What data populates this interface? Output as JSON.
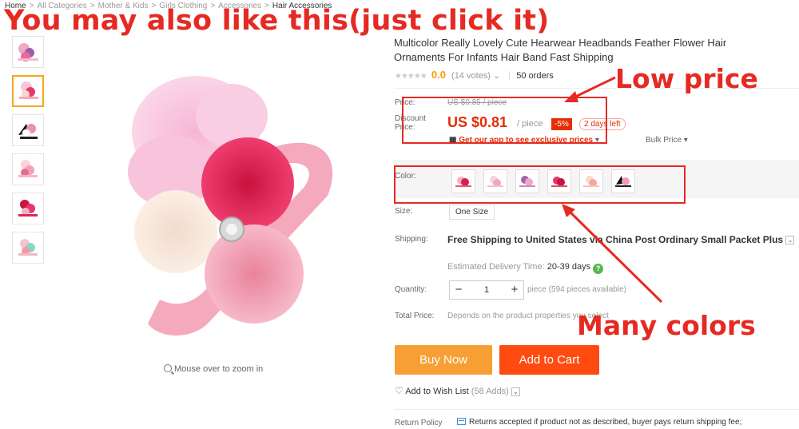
{
  "breadcrumb": [
    "Home",
    "All Categories",
    "Mother & Kids",
    "Girls Clothing",
    "Accessories",
    "Hair Accessories"
  ],
  "breadcrumb_sep": ">",
  "overlay_banner": "You may also like this(just click it)",
  "product": {
    "title": "Multicolor Really Lovely Cute Hearwear Headbands Feather Flower Hair Ornaments For Infants Hair Band Fast Shipping",
    "rating_value": "0.0",
    "votes": "(14 votes)",
    "orders": "50 orders"
  },
  "price": {
    "label": "Price:",
    "old": "US $0.85 / piece",
    "discount_label": "Discount Price:",
    "discount": "US $0.81",
    "per_piece": "/ piece",
    "off_badge": "-5%",
    "days_left": "2 days left",
    "app_link": "Get our app to see exclusive prices",
    "bulk_price": "Bulk Price"
  },
  "color": {
    "label": "Color:",
    "swatches": [
      "red-pink headband",
      "light-pink headband",
      "purple headband",
      "hot-pink headband",
      "peach headband",
      "black-pink headband"
    ]
  },
  "size": {
    "label": "Size:",
    "option": "One Size"
  },
  "shipping": {
    "label": "Shipping:",
    "text": "Free Shipping to United States via China Post Ordinary Small Packet Plus",
    "delivery_label": "Estimated Delivery Time:",
    "delivery_time": "20-39 days"
  },
  "quantity": {
    "label": "Quantity:",
    "value": "1",
    "minus": "−",
    "plus": "+",
    "note": "piece (594 pieces available)"
  },
  "total": {
    "label": "Total Price:",
    "note": "Depends on the product properties you select"
  },
  "buttons": {
    "buy_now": "Buy Now",
    "add_to_cart": "Add to Cart"
  },
  "wishlist": {
    "label": "Add to Wish List",
    "adds": "(58 Adds)"
  },
  "returns": {
    "label": "Return Policy",
    "text": "Returns accepted if product not as described, buyer pays return shipping fee;"
  },
  "zoom_hint": "Mouse over to zoom in",
  "annotations": {
    "low_price": "Low price",
    "many_colors": "Many colors"
  },
  "colors": {
    "accent": "#e62e04",
    "annotation": "#e52a23",
    "buy_now": "#f79f34",
    "add_to_cart": "#ff4b10",
    "active_thumb": "#f0a81f"
  }
}
